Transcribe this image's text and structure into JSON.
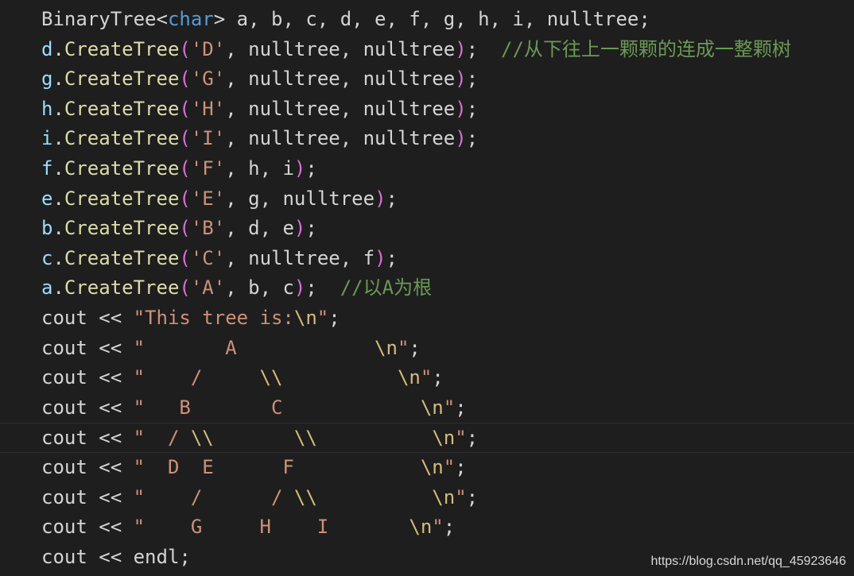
{
  "colors": {
    "background": "#1e1e1e",
    "default": "#d4d4d4",
    "type": "#4ec9b0",
    "keyword": "#569cd6",
    "variable": "#9cdcfe",
    "method": "#dcdcaa",
    "string": "#ce9178",
    "escape": "#d7ba7d",
    "paren": "#da70d6",
    "comment": "#6a9955",
    "current_line_border": "#2e2e2e"
  },
  "editor": {
    "current_line_index": 14,
    "lines": [
      [
        [
          "BinaryTree",
          "default"
        ],
        [
          "<",
          "default"
        ],
        [
          "char",
          "keyword"
        ],
        [
          "> a, b, c, d, e, f, g, h, i, nulltree;",
          "default"
        ]
      ],
      [
        [
          "d",
          "variable"
        ],
        [
          ".",
          "default"
        ],
        [
          "CreateTree",
          "method"
        ],
        [
          "(",
          "paren"
        ],
        [
          "'D'",
          "string"
        ],
        [
          ", nulltree, nulltree",
          "default"
        ],
        [
          ")",
          "paren"
        ],
        [
          ";  ",
          "default"
        ],
        [
          "//从下往上一颗颗的连成一整颗树",
          "comment"
        ]
      ],
      [
        [
          "g",
          "variable"
        ],
        [
          ".",
          "default"
        ],
        [
          "CreateTree",
          "method"
        ],
        [
          "(",
          "paren"
        ],
        [
          "'G'",
          "string"
        ],
        [
          ", nulltree, nulltree",
          "default"
        ],
        [
          ")",
          "paren"
        ],
        [
          ";",
          "default"
        ]
      ],
      [
        [
          "h",
          "variable"
        ],
        [
          ".",
          "default"
        ],
        [
          "CreateTree",
          "method"
        ],
        [
          "(",
          "paren"
        ],
        [
          "'H'",
          "string"
        ],
        [
          ", nulltree, nulltree",
          "default"
        ],
        [
          ")",
          "paren"
        ],
        [
          ";",
          "default"
        ]
      ],
      [
        [
          "i",
          "variable"
        ],
        [
          ".",
          "default"
        ],
        [
          "CreateTree",
          "method"
        ],
        [
          "(",
          "paren"
        ],
        [
          "'I'",
          "string"
        ],
        [
          ", nulltree, nulltree",
          "default"
        ],
        [
          ")",
          "paren"
        ],
        [
          ";",
          "default"
        ]
      ],
      [
        [
          "f",
          "variable"
        ],
        [
          ".",
          "default"
        ],
        [
          "CreateTree",
          "method"
        ],
        [
          "(",
          "paren"
        ],
        [
          "'F'",
          "string"
        ],
        [
          ", h, i",
          "default"
        ],
        [
          ")",
          "paren"
        ],
        [
          ";",
          "default"
        ]
      ],
      [
        [
          "e",
          "variable"
        ],
        [
          ".",
          "default"
        ],
        [
          "CreateTree",
          "method"
        ],
        [
          "(",
          "paren"
        ],
        [
          "'E'",
          "string"
        ],
        [
          ", g, nulltree",
          "default"
        ],
        [
          ")",
          "paren"
        ],
        [
          ";",
          "default"
        ]
      ],
      [
        [
          "b",
          "variable"
        ],
        [
          ".",
          "default"
        ],
        [
          "CreateTree",
          "method"
        ],
        [
          "(",
          "paren"
        ],
        [
          "'B'",
          "string"
        ],
        [
          ", d, e",
          "default"
        ],
        [
          ")",
          "paren"
        ],
        [
          ";",
          "default"
        ]
      ],
      [
        [
          "c",
          "variable"
        ],
        [
          ".",
          "default"
        ],
        [
          "CreateTree",
          "method"
        ],
        [
          "(",
          "paren"
        ],
        [
          "'C'",
          "string"
        ],
        [
          ", nulltree, f",
          "default"
        ],
        [
          ")",
          "paren"
        ],
        [
          ";",
          "default"
        ]
      ],
      [
        [
          "a",
          "variable"
        ],
        [
          ".",
          "default"
        ],
        [
          "CreateTree",
          "method"
        ],
        [
          "(",
          "paren"
        ],
        [
          "'A'",
          "string"
        ],
        [
          ", b, c",
          "default"
        ],
        [
          ")",
          "paren"
        ],
        [
          ";  ",
          "default"
        ],
        [
          "//以A为根",
          "comment"
        ]
      ],
      [
        [
          "cout << ",
          "default"
        ],
        [
          "\"This tree is:",
          "string"
        ],
        [
          "\\n",
          "escape"
        ],
        [
          "\"",
          "string"
        ],
        [
          ";",
          "default"
        ]
      ],
      [
        [
          "cout << ",
          "default"
        ],
        [
          "\"       A            ",
          "string"
        ],
        [
          "\\n",
          "escape"
        ],
        [
          "\"",
          "string"
        ],
        [
          ";",
          "default"
        ]
      ],
      [
        [
          "cout << ",
          "default"
        ],
        [
          "\"    /     ",
          "string"
        ],
        [
          "\\\\",
          "escape"
        ],
        [
          "          ",
          "string"
        ],
        [
          "\\n",
          "escape"
        ],
        [
          "\"",
          "string"
        ],
        [
          ";",
          "default"
        ]
      ],
      [
        [
          "cout << ",
          "default"
        ],
        [
          "\"   B       C            ",
          "string"
        ],
        [
          "\\n",
          "escape"
        ],
        [
          "\"",
          "string"
        ],
        [
          ";",
          "default"
        ]
      ],
      [
        [
          "cout << ",
          "default"
        ],
        [
          "\"  / ",
          "string"
        ],
        [
          "\\\\",
          "escape"
        ],
        [
          "       ",
          "string"
        ],
        [
          "\\\\",
          "escape"
        ],
        [
          "          ",
          "string"
        ],
        [
          "\\n",
          "escape"
        ],
        [
          "\"",
          "string"
        ],
        [
          ";",
          "default"
        ]
      ],
      [
        [
          "cout << ",
          "default"
        ],
        [
          "\"  D  E      F           ",
          "string"
        ],
        [
          "\\n",
          "escape"
        ],
        [
          "\"",
          "string"
        ],
        [
          ";",
          "default"
        ]
      ],
      [
        [
          "cout << ",
          "default"
        ],
        [
          "\"    /      / ",
          "string"
        ],
        [
          "\\\\",
          "escape"
        ],
        [
          "          ",
          "string"
        ],
        [
          "\\n",
          "escape"
        ],
        [
          "\"",
          "string"
        ],
        [
          ";",
          "default"
        ]
      ],
      [
        [
          "cout << ",
          "default"
        ],
        [
          "\"    G     H    I       ",
          "string"
        ],
        [
          "\\n",
          "escape"
        ],
        [
          "\"",
          "string"
        ],
        [
          ";",
          "default"
        ]
      ],
      [
        [
          "cout << endl;",
          "default"
        ]
      ]
    ]
  },
  "watermark": "https://blog.csdn.net/qq_45923646"
}
